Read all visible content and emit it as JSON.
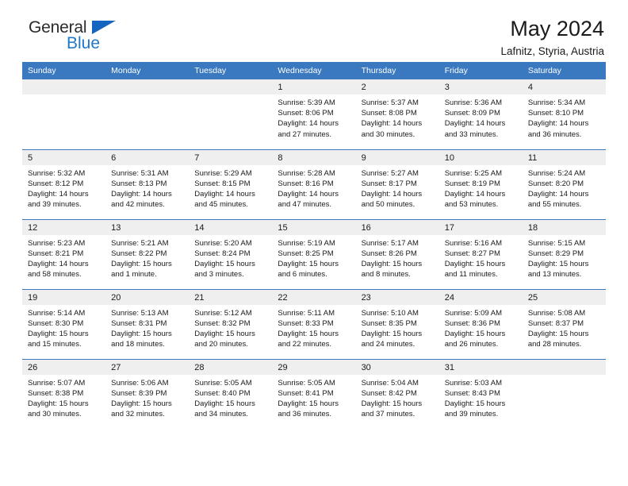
{
  "brand": {
    "line1": "General",
    "line2": "Blue",
    "triangle_color": "#1565c0",
    "blue_color": "#1f78c8"
  },
  "header": {
    "title": "May 2024",
    "subtitle": "Lafnitz, Styria, Austria",
    "accent_color": "#3a79bf"
  },
  "weekdays": [
    "Sunday",
    "Monday",
    "Tuesday",
    "Wednesday",
    "Thursday",
    "Friday",
    "Saturday"
  ],
  "labels": {
    "sunrise_prefix": "Sunrise:",
    "sunset_prefix": "Sunset:",
    "daylight_prefix": "Daylight:"
  },
  "weeks": [
    [
      {
        "day": "",
        "sunrise": "",
        "sunset": "",
        "daylight_1": "",
        "daylight_2": ""
      },
      {
        "day": "",
        "sunrise": "",
        "sunset": "",
        "daylight_1": "",
        "daylight_2": ""
      },
      {
        "day": "",
        "sunrise": "",
        "sunset": "",
        "daylight_1": "",
        "daylight_2": ""
      },
      {
        "day": "1",
        "sunrise": "Sunrise: 5:39 AM",
        "sunset": "Sunset: 8:06 PM",
        "daylight_1": "Daylight: 14 hours",
        "daylight_2": "and 27 minutes."
      },
      {
        "day": "2",
        "sunrise": "Sunrise: 5:37 AM",
        "sunset": "Sunset: 8:08 PM",
        "daylight_1": "Daylight: 14 hours",
        "daylight_2": "and 30 minutes."
      },
      {
        "day": "3",
        "sunrise": "Sunrise: 5:36 AM",
        "sunset": "Sunset: 8:09 PM",
        "daylight_1": "Daylight: 14 hours",
        "daylight_2": "and 33 minutes."
      },
      {
        "day": "4",
        "sunrise": "Sunrise: 5:34 AM",
        "sunset": "Sunset: 8:10 PM",
        "daylight_1": "Daylight: 14 hours",
        "daylight_2": "and 36 minutes."
      }
    ],
    [
      {
        "day": "5",
        "sunrise": "Sunrise: 5:32 AM",
        "sunset": "Sunset: 8:12 PM",
        "daylight_1": "Daylight: 14 hours",
        "daylight_2": "and 39 minutes."
      },
      {
        "day": "6",
        "sunrise": "Sunrise: 5:31 AM",
        "sunset": "Sunset: 8:13 PM",
        "daylight_1": "Daylight: 14 hours",
        "daylight_2": "and 42 minutes."
      },
      {
        "day": "7",
        "sunrise": "Sunrise: 5:29 AM",
        "sunset": "Sunset: 8:15 PM",
        "daylight_1": "Daylight: 14 hours",
        "daylight_2": "and 45 minutes."
      },
      {
        "day": "8",
        "sunrise": "Sunrise: 5:28 AM",
        "sunset": "Sunset: 8:16 PM",
        "daylight_1": "Daylight: 14 hours",
        "daylight_2": "and 47 minutes."
      },
      {
        "day": "9",
        "sunrise": "Sunrise: 5:27 AM",
        "sunset": "Sunset: 8:17 PM",
        "daylight_1": "Daylight: 14 hours",
        "daylight_2": "and 50 minutes."
      },
      {
        "day": "10",
        "sunrise": "Sunrise: 5:25 AM",
        "sunset": "Sunset: 8:19 PM",
        "daylight_1": "Daylight: 14 hours",
        "daylight_2": "and 53 minutes."
      },
      {
        "day": "11",
        "sunrise": "Sunrise: 5:24 AM",
        "sunset": "Sunset: 8:20 PM",
        "daylight_1": "Daylight: 14 hours",
        "daylight_2": "and 55 minutes."
      }
    ],
    [
      {
        "day": "12",
        "sunrise": "Sunrise: 5:23 AM",
        "sunset": "Sunset: 8:21 PM",
        "daylight_1": "Daylight: 14 hours",
        "daylight_2": "and 58 minutes."
      },
      {
        "day": "13",
        "sunrise": "Sunrise: 5:21 AM",
        "sunset": "Sunset: 8:22 PM",
        "daylight_1": "Daylight: 15 hours",
        "daylight_2": "and 1 minute."
      },
      {
        "day": "14",
        "sunrise": "Sunrise: 5:20 AM",
        "sunset": "Sunset: 8:24 PM",
        "daylight_1": "Daylight: 15 hours",
        "daylight_2": "and 3 minutes."
      },
      {
        "day": "15",
        "sunrise": "Sunrise: 5:19 AM",
        "sunset": "Sunset: 8:25 PM",
        "daylight_1": "Daylight: 15 hours",
        "daylight_2": "and 6 minutes."
      },
      {
        "day": "16",
        "sunrise": "Sunrise: 5:17 AM",
        "sunset": "Sunset: 8:26 PM",
        "daylight_1": "Daylight: 15 hours",
        "daylight_2": "and 8 minutes."
      },
      {
        "day": "17",
        "sunrise": "Sunrise: 5:16 AM",
        "sunset": "Sunset: 8:27 PM",
        "daylight_1": "Daylight: 15 hours",
        "daylight_2": "and 11 minutes."
      },
      {
        "day": "18",
        "sunrise": "Sunrise: 5:15 AM",
        "sunset": "Sunset: 8:29 PM",
        "daylight_1": "Daylight: 15 hours",
        "daylight_2": "and 13 minutes."
      }
    ],
    [
      {
        "day": "19",
        "sunrise": "Sunrise: 5:14 AM",
        "sunset": "Sunset: 8:30 PM",
        "daylight_1": "Daylight: 15 hours",
        "daylight_2": "and 15 minutes."
      },
      {
        "day": "20",
        "sunrise": "Sunrise: 5:13 AM",
        "sunset": "Sunset: 8:31 PM",
        "daylight_1": "Daylight: 15 hours",
        "daylight_2": "and 18 minutes."
      },
      {
        "day": "21",
        "sunrise": "Sunrise: 5:12 AM",
        "sunset": "Sunset: 8:32 PM",
        "daylight_1": "Daylight: 15 hours",
        "daylight_2": "and 20 minutes."
      },
      {
        "day": "22",
        "sunrise": "Sunrise: 5:11 AM",
        "sunset": "Sunset: 8:33 PM",
        "daylight_1": "Daylight: 15 hours",
        "daylight_2": "and 22 minutes."
      },
      {
        "day": "23",
        "sunrise": "Sunrise: 5:10 AM",
        "sunset": "Sunset: 8:35 PM",
        "daylight_1": "Daylight: 15 hours",
        "daylight_2": "and 24 minutes."
      },
      {
        "day": "24",
        "sunrise": "Sunrise: 5:09 AM",
        "sunset": "Sunset: 8:36 PM",
        "daylight_1": "Daylight: 15 hours",
        "daylight_2": "and 26 minutes."
      },
      {
        "day": "25",
        "sunrise": "Sunrise: 5:08 AM",
        "sunset": "Sunset: 8:37 PM",
        "daylight_1": "Daylight: 15 hours",
        "daylight_2": "and 28 minutes."
      }
    ],
    [
      {
        "day": "26",
        "sunrise": "Sunrise: 5:07 AM",
        "sunset": "Sunset: 8:38 PM",
        "daylight_1": "Daylight: 15 hours",
        "daylight_2": "and 30 minutes."
      },
      {
        "day": "27",
        "sunrise": "Sunrise: 5:06 AM",
        "sunset": "Sunset: 8:39 PM",
        "daylight_1": "Daylight: 15 hours",
        "daylight_2": "and 32 minutes."
      },
      {
        "day": "28",
        "sunrise": "Sunrise: 5:05 AM",
        "sunset": "Sunset: 8:40 PM",
        "daylight_1": "Daylight: 15 hours",
        "daylight_2": "and 34 minutes."
      },
      {
        "day": "29",
        "sunrise": "Sunrise: 5:05 AM",
        "sunset": "Sunset: 8:41 PM",
        "daylight_1": "Daylight: 15 hours",
        "daylight_2": "and 36 minutes."
      },
      {
        "day": "30",
        "sunrise": "Sunrise: 5:04 AM",
        "sunset": "Sunset: 8:42 PM",
        "daylight_1": "Daylight: 15 hours",
        "daylight_2": "and 37 minutes."
      },
      {
        "day": "31",
        "sunrise": "Sunrise: 5:03 AM",
        "sunset": "Sunset: 8:43 PM",
        "daylight_1": "Daylight: 15 hours",
        "daylight_2": "and 39 minutes."
      },
      {
        "day": "",
        "sunrise": "",
        "sunset": "",
        "daylight_1": "",
        "daylight_2": ""
      }
    ]
  ]
}
